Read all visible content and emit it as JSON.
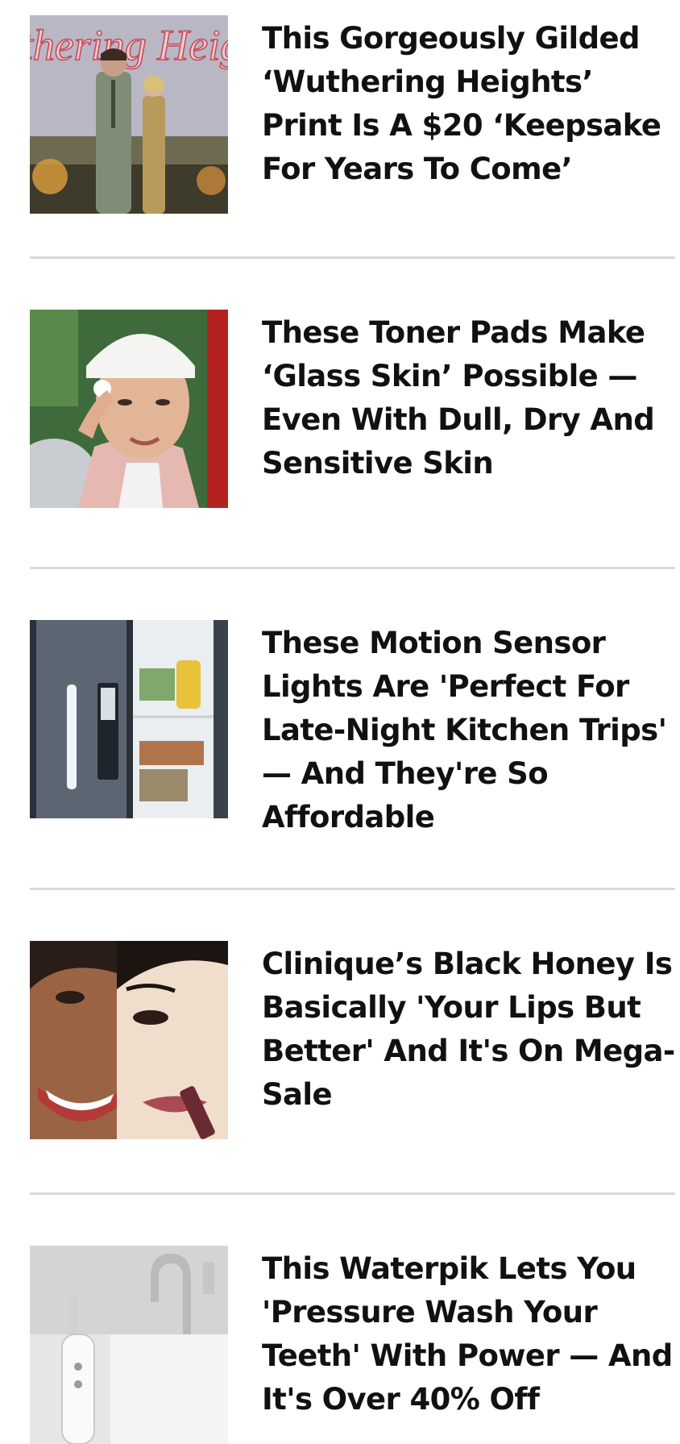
{
  "articles": [
    {
      "headline": "This Gorgeously Gilded ‘Wuthering Heights’ Print Is A $20 ‘Keepsake For Years To Come’",
      "thumbnail": "wuthering-heights-premiere-photo",
      "thumbnail_text": "Wuthering Heights"
    },
    {
      "headline": "These Toner Pads Make ‘Glass Skin’ Possible — Even With Dull, Dry And Sensitive Skin",
      "thumbnail": "woman-applying-toner-pad-photo"
    },
    {
      "headline": "These Motion Sensor Lights Are 'Perfect For Late-Night Kitchen Trips' — And They're So Affordable",
      "thumbnail": "refrigerator-with-motion-light-photo"
    },
    {
      "headline": "Clinique’s Black Honey Is Basically 'Your Lips But Better' And It's On Mega-Sale",
      "thumbnail": "split-face-lipstick-photo"
    },
    {
      "headline": "This Waterpik Lets You 'Pressure Wash Your Teeth' With Power — And It's Over 40% Off",
      "thumbnail": "waterpik-at-sink-photo"
    }
  ],
  "colors": {
    "text": "#111111",
    "divider": "#d9d9d9",
    "background": "#ffffff"
  }
}
